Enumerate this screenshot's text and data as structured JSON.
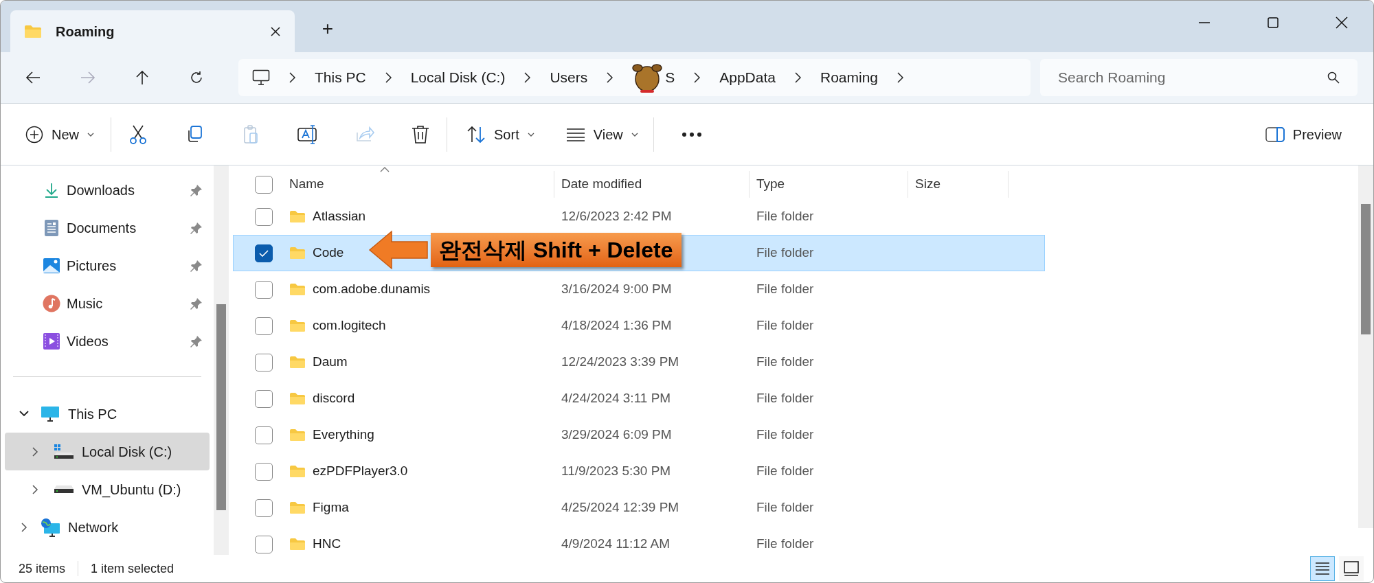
{
  "window": {
    "tab_title": "Roaming",
    "new_tab": "+"
  },
  "breadcrumb": [
    {
      "label": "This PC",
      "kind": "plain"
    },
    {
      "label": "Local Disk (C:)",
      "kind": "plain"
    },
    {
      "label": "Users",
      "kind": "plain"
    },
    {
      "label": "S",
      "kind": "covered"
    },
    {
      "label": "AppData",
      "kind": "plain"
    },
    {
      "label": "Roaming",
      "kind": "plain"
    }
  ],
  "search": {
    "placeholder": "Search Roaming"
  },
  "toolbar": {
    "new": "New",
    "sort": "Sort",
    "view": "View",
    "preview": "Preview"
  },
  "sidebar": {
    "quick_access": [
      {
        "label": "Downloads",
        "kind": "downloads",
        "pinned": true
      },
      {
        "label": "Documents",
        "kind": "documents",
        "pinned": true
      },
      {
        "label": "Pictures",
        "kind": "pictures",
        "pinned": true
      },
      {
        "label": "Music",
        "kind": "music",
        "pinned": true
      },
      {
        "label": "Videos",
        "kind": "videos",
        "pinned": true
      }
    ],
    "tree": [
      {
        "label": "This PC",
        "kind": "pc",
        "expanded": true,
        "selected": false,
        "children": [
          {
            "label": "Local Disk (C:)",
            "kind": "windows-drive",
            "expanded": false,
            "selected": true
          },
          {
            "label": "VM_Ubuntu (D:)",
            "kind": "drive",
            "expanded": false,
            "selected": false
          }
        ]
      },
      {
        "label": "Network",
        "kind": "network",
        "expanded": false,
        "selected": false
      }
    ]
  },
  "table": {
    "select_all": {
      "checked": false
    },
    "columns": [
      "Name",
      "Date modified",
      "Type",
      "Size"
    ],
    "rows": [
      {
        "name": "Atlassian",
        "date": "12/6/2023 2:42 PM",
        "type": "File folder",
        "selected": false
      },
      {
        "name": "Code",
        "type": "File folder",
        "selected": true
      },
      {
        "name": "com.adobe.dunamis",
        "date": "3/16/2024 9:00 PM",
        "type": "File folder",
        "selected": false
      },
      {
        "name": "com.logitech",
        "date": "4/18/2024 1:36 PM",
        "type": "File folder",
        "selected": false
      },
      {
        "name": "Daum",
        "date": "12/24/2023 3:39 PM",
        "type": "File folder",
        "selected": false
      },
      {
        "name": "discord",
        "date": "4/24/2024 3:11 PM",
        "type": "File folder",
        "selected": false
      },
      {
        "name": "Everything",
        "date": "3/29/2024 6:09 PM",
        "type": "File folder",
        "selected": false
      },
      {
        "name": "ezPDFPlayer3.0",
        "date": "11/9/2023 5:30 PM",
        "type": "File folder",
        "selected": false
      },
      {
        "name": "Figma",
        "date": "4/25/2024 12:39 PM",
        "type": "File folder",
        "selected": false
      },
      {
        "name": "HNC",
        "date": "4/9/2024 11:12 AM",
        "type": "File folder",
        "selected": false
      }
    ]
  },
  "annotation": {
    "text": "완전삭제 Shift + Delete"
  },
  "status_bar": {
    "count": "25 items",
    "selection": "1 item selected"
  },
  "view_buttons": [
    {
      "kind": "details",
      "selected": true
    },
    {
      "kind": "tiles",
      "selected": false
    }
  ]
}
